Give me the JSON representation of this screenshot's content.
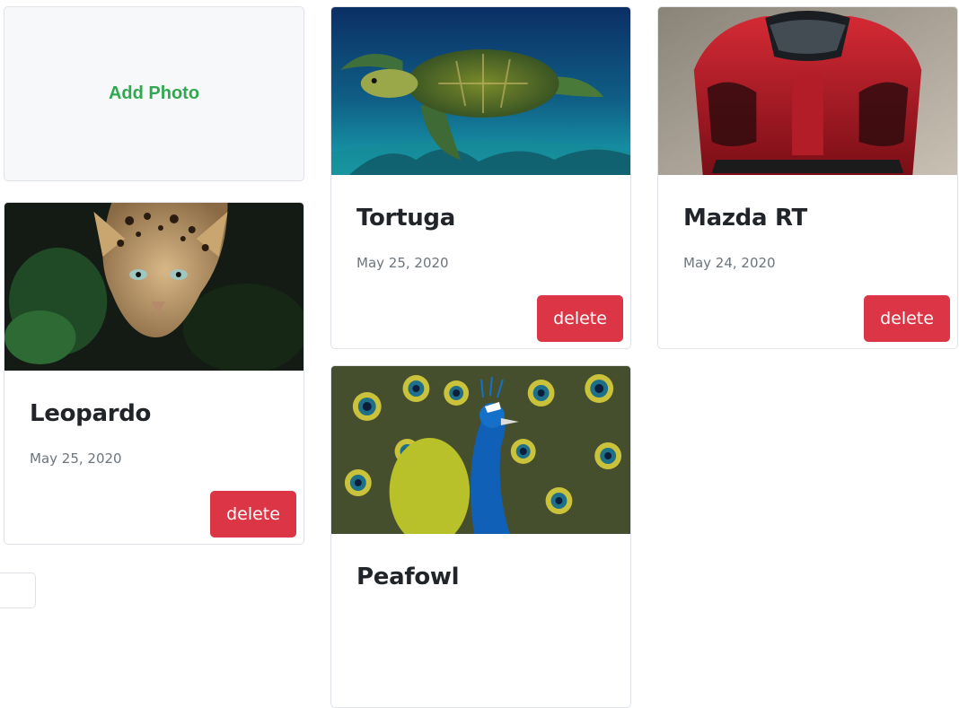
{
  "add_card": {
    "label": "Add Photo"
  },
  "photos": [
    {
      "title": "Tortuga",
      "date": "May 25, 2020",
      "delete_label": "delete",
      "image": "sea-turtle"
    },
    {
      "title": "Mazda RT",
      "date": "May 24, 2020",
      "delete_label": "delete",
      "image": "red-race-car"
    },
    {
      "title": "Leopardo",
      "date": "May 25, 2020",
      "delete_label": "delete",
      "image": "leopard"
    },
    {
      "title": "Peafowl",
      "image": "peacock"
    }
  ],
  "colors": {
    "accent_green": "#2fa84f",
    "danger": "#dc3545",
    "muted_text": "#6c757d",
    "title_text": "#212529"
  }
}
